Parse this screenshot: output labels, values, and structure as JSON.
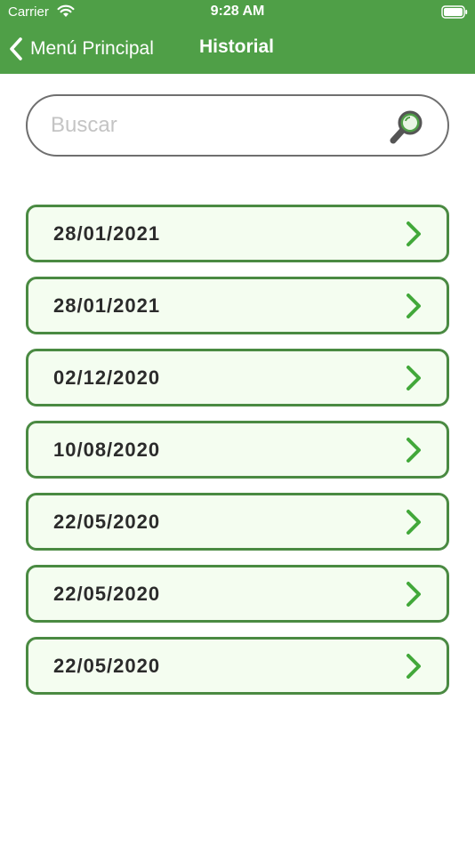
{
  "status_bar": {
    "carrier": "Carrier",
    "time": "9:28 AM",
    "wifi_icon": "wifi-icon",
    "battery_icon": "battery-icon"
  },
  "nav": {
    "back_label": "Menú Principal",
    "back_icon": "chevron-left-icon",
    "title": "Historial"
  },
  "search": {
    "placeholder": "Buscar",
    "value": "",
    "icon": "magnifier-icon"
  },
  "history": {
    "items": [
      {
        "label": "28/01/2021"
      },
      {
        "label": "28/01/2021"
      },
      {
        "label": "02/12/2020"
      },
      {
        "label": "10/08/2020"
      },
      {
        "label": "22/05/2020"
      },
      {
        "label": "22/05/2020"
      },
      {
        "label": "22/05/2020"
      }
    ],
    "chevron_icon": "chevron-right-icon"
  },
  "colors": {
    "header_green": "#4f9f47",
    "item_border": "#4a8a42",
    "item_background": "#f4fdf0",
    "chevron_green": "#42a83a"
  }
}
